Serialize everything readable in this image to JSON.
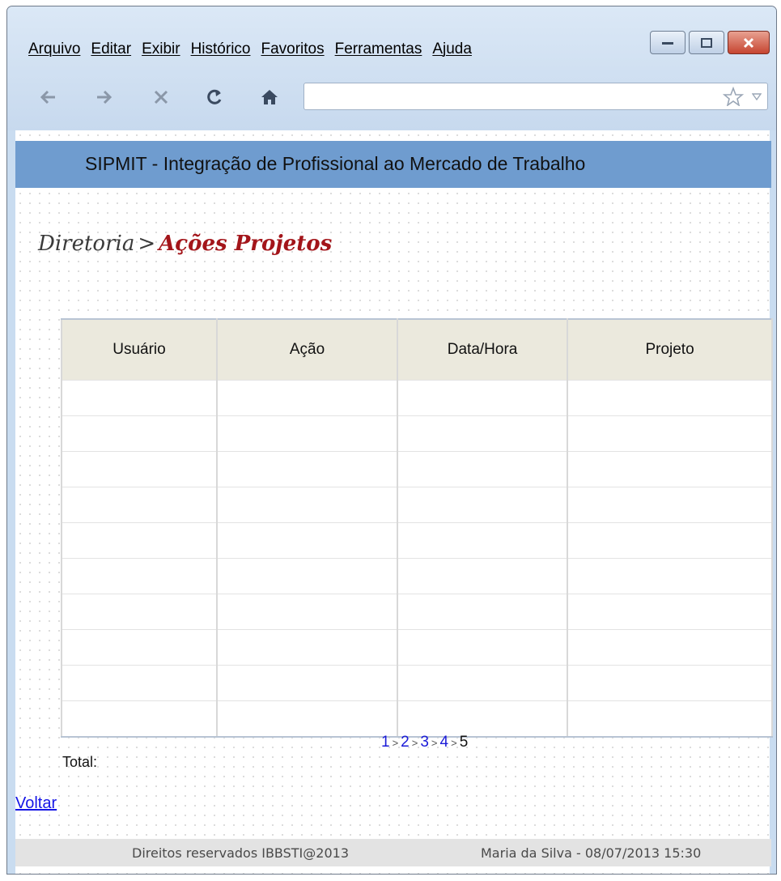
{
  "menu": [
    "Arquivo",
    "Editar",
    "Exibir",
    "Histórico",
    "Favoritos",
    "Ferramentas",
    "Ajuda"
  ],
  "nav": {
    "back_icon": "arrow-left",
    "forward_icon": "arrow-right",
    "stop_icon": "x",
    "reload_icon": "reload",
    "home_icon": "house",
    "url": "",
    "bookmark_icon": "star"
  },
  "banner": {
    "title": "SIPMIT - Integração de Profissional ao Mercado de Trabalho",
    "color": "#6f9ccf"
  },
  "breadcrumb": {
    "parent": "Diretoria",
    "separator": ">",
    "current": "Ações Projetos",
    "current_color": "#a3151a"
  },
  "table": {
    "headers": [
      "Usuário",
      "Ação",
      "Data/Hora",
      "Projeto"
    ],
    "rows": [
      [
        "",
        "",
        "",
        ""
      ],
      [
        "",
        "",
        "",
        ""
      ],
      [
        "",
        "",
        "",
        ""
      ],
      [
        "",
        "",
        "",
        ""
      ],
      [
        "",
        "",
        "",
        ""
      ],
      [
        "",
        "",
        "",
        ""
      ],
      [
        "",
        "",
        "",
        ""
      ],
      [
        "",
        "",
        "",
        ""
      ],
      [
        "",
        "",
        "",
        ""
      ],
      [
        "",
        "",
        "",
        ""
      ]
    ]
  },
  "pagination": {
    "pages": [
      "1",
      "2",
      "3",
      "4",
      "5"
    ],
    "separator": ">",
    "current": "5"
  },
  "total_label": "Total:",
  "back_link": "Voltar",
  "footer": {
    "left": "Direitos reservados IBBSTI@2013",
    "right": "Maria da Silva - 08/07/2013 15:30"
  }
}
